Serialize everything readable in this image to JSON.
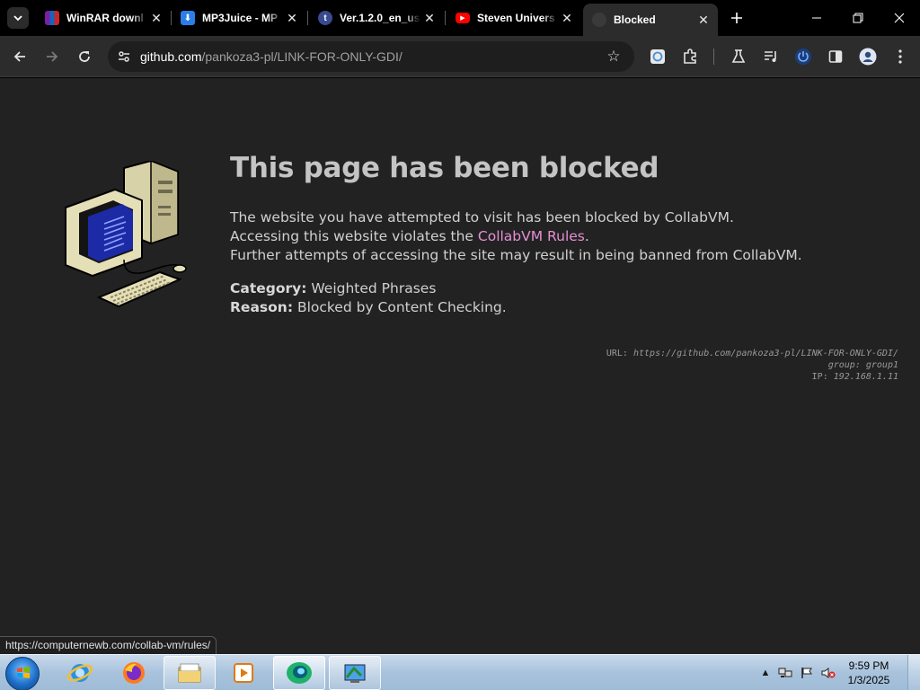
{
  "tabs": [
    {
      "title": "WinRAR downl",
      "favicon": "winrar-icon",
      "color": "#8b1a1a"
    },
    {
      "title": "MP3Juice - MP",
      "favicon": "download-icon",
      "color": "#2b7de9"
    },
    {
      "title": "Ver.1.2.0_en_us",
      "favicon": "tumblr-icon",
      "color": "#3a4a8f"
    },
    {
      "title": "Steven Univers",
      "favicon": "youtube-icon",
      "color": "#ff0000"
    },
    {
      "title": "Blocked",
      "favicon": "github-icon",
      "color": "#3a3a3a"
    }
  ],
  "omnibox": {
    "host": "github.com",
    "path": "/pankoza3-pl/LINK-FOR-ONLY-GDI/"
  },
  "page": {
    "title": "This page has been blocked",
    "line1": "The website you have attempted to visit has been blocked by CollabVM.",
    "line2_pre": "Accessing this website violates the ",
    "line2_link": "CollabVM Rules",
    "line2_post": ".",
    "line3": "Further attempts of accessing the site may result in being banned from CollabVM.",
    "category_label": "Category:",
    "category_value": " Weighted Phrases",
    "reason_label": "Reason:",
    "reason_value": " Blocked by Content Checking.",
    "meta_url_label": "URL: ",
    "meta_url_value": "https://github.com/pankoza3-pl/LINK-FOR-ONLY-GDI/",
    "meta_group_label": "group: ",
    "meta_group_value": "group1",
    "meta_ip_label": "IP: ",
    "meta_ip_value": "192.168.1.11"
  },
  "status_url": "https://computernewb.com/collab-vm/rules/",
  "taskbar": {
    "apps": [
      "internet-explorer-icon",
      "firefox-icon",
      "file-explorer-icon",
      "media-player-icon",
      "chrome-icon",
      "control-panel-icon"
    ],
    "clock_time": "9:59 PM",
    "clock_date": "1/3/2025"
  },
  "colors": {
    "page_bg": "#222222",
    "link": "#e58fd4",
    "toolbar": "#2c2c2c"
  }
}
